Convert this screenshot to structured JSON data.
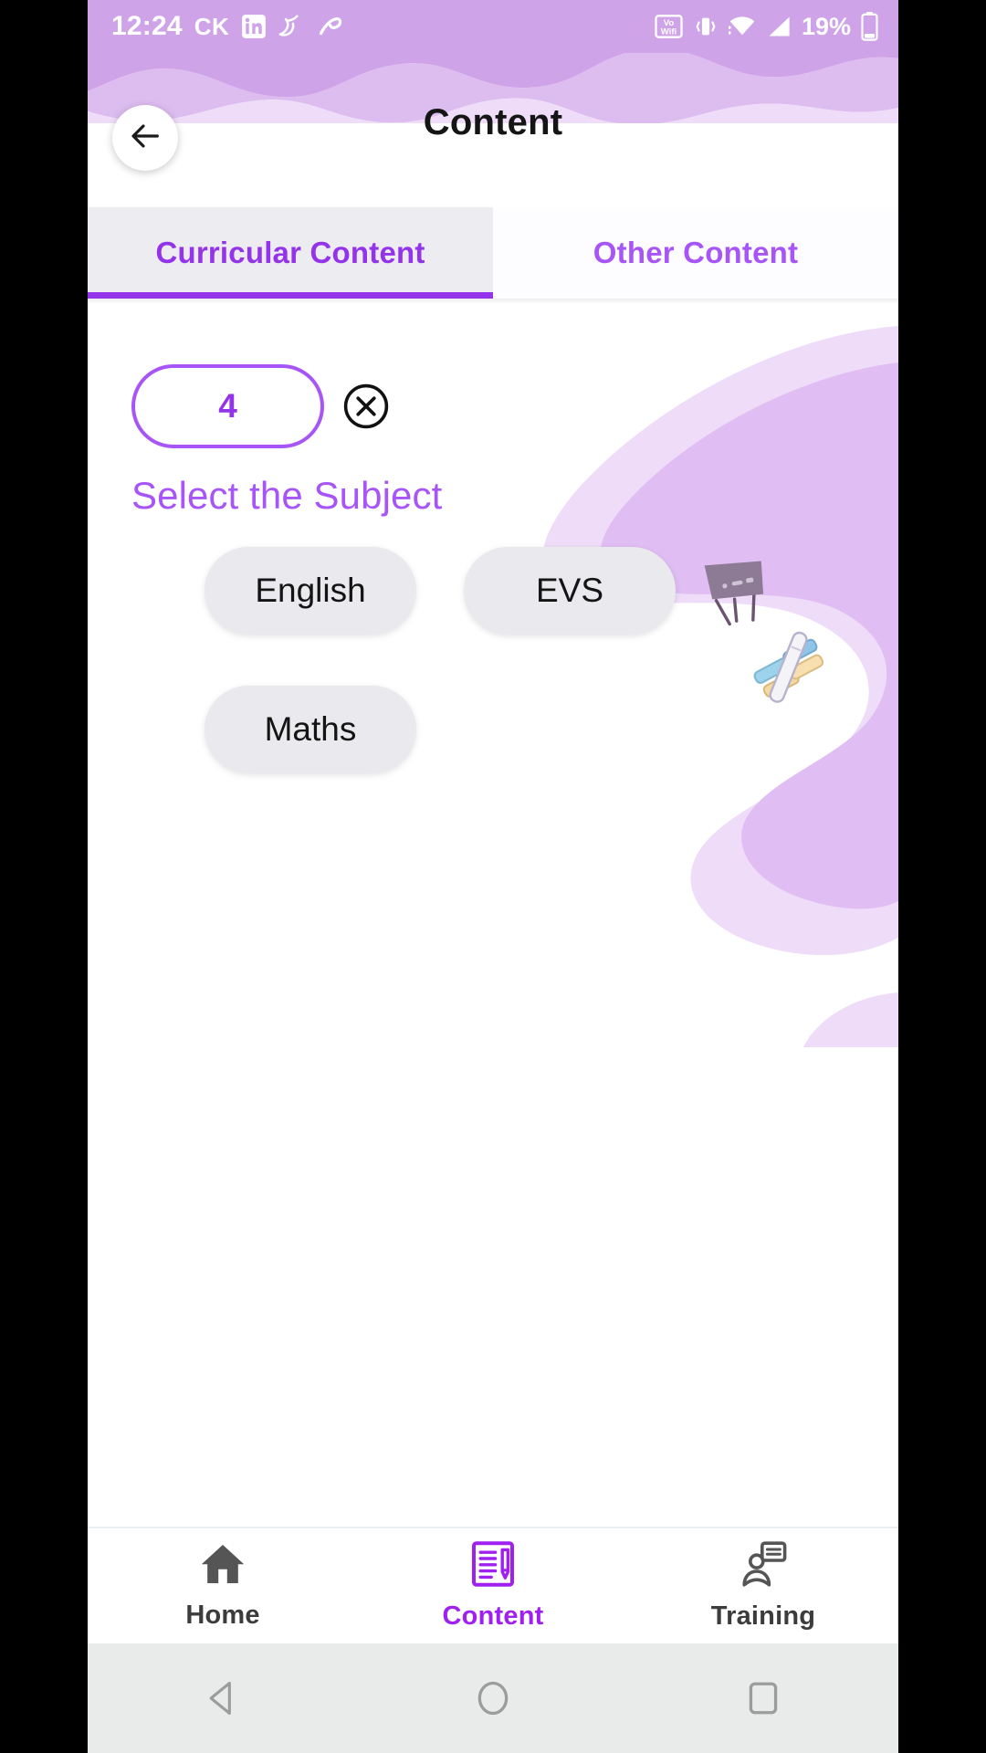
{
  "statusbar": {
    "time": "12:24",
    "carrier": "CK",
    "icons_left": [
      "linkedin-icon",
      "snapchat-icon",
      "airtel-icon"
    ],
    "icons_right": [
      "vowifi-icon",
      "vibrate-icon",
      "wifi-icon",
      "signal-icon"
    ],
    "battery": "19%",
    "background_color": "#cfa3e8"
  },
  "appbar": {
    "title": "Content",
    "back_icon": "arrow-left-icon"
  },
  "tabs": [
    {
      "label": "Curricular Content",
      "active": true
    },
    {
      "label": "Other Content",
      "active": false
    }
  ],
  "filters": {
    "class_chip_value": "4",
    "clear_icon": "circle-x-icon"
  },
  "main": {
    "section_label": "Select the Subject",
    "subjects": [
      "English",
      "EVS",
      "Maths"
    ]
  },
  "bottomnav": [
    {
      "label": "Home",
      "icon": "home-icon",
      "active": false
    },
    {
      "label": "Content",
      "icon": "document-pencil-icon",
      "active": true
    },
    {
      "label": "Training",
      "icon": "person-board-icon",
      "active": false
    }
  ],
  "androidnav": [
    {
      "icon": "back-triangle-icon"
    },
    {
      "icon": "home-circle-icon"
    },
    {
      "icon": "recents-square-icon"
    }
  ],
  "colors": {
    "accent": "#a855f7",
    "accent_dark": "#9333ea",
    "status_bg": "#cfa3e8",
    "chip_bg": "#eaeaee",
    "tab_active_bg": "#ececf1"
  }
}
